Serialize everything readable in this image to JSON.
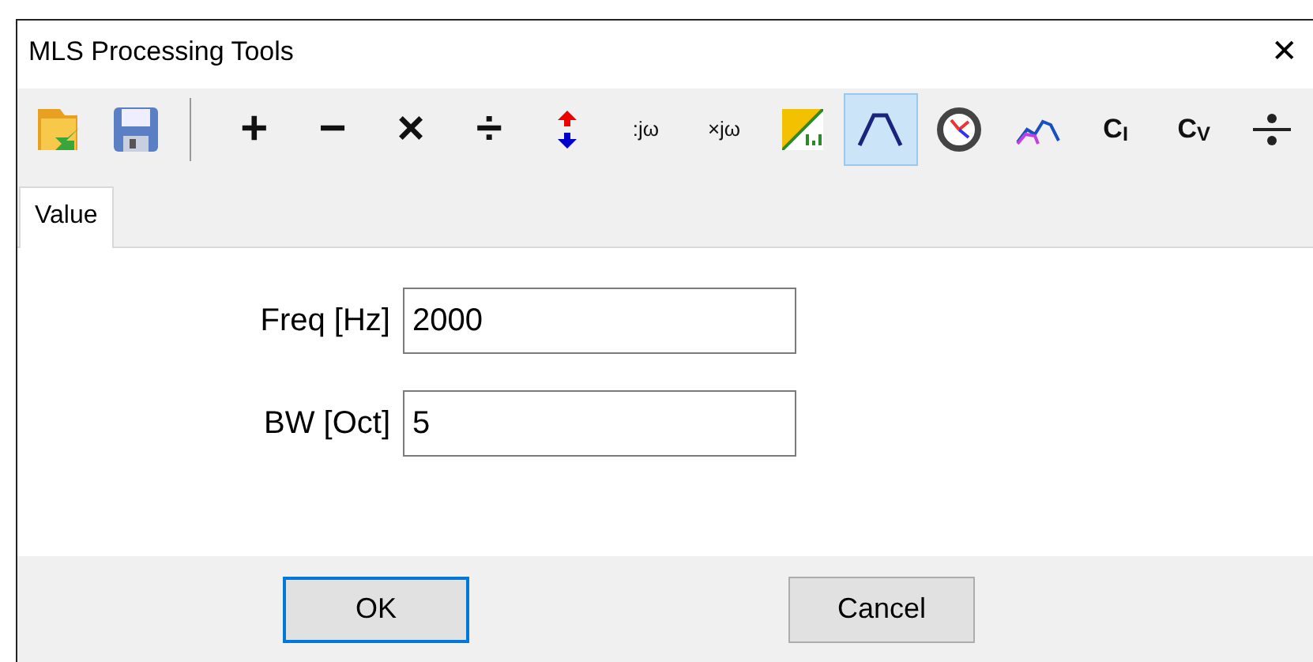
{
  "window": {
    "title": "MLS Processing Tools",
    "close": "✕"
  },
  "toolbar": [
    {
      "kind": "open",
      "selected": false
    },
    {
      "kind": "save",
      "selected": false
    },
    {
      "kind": "separator"
    },
    {
      "kind": "text",
      "label": "+",
      "selected": false
    },
    {
      "kind": "text",
      "label": "−",
      "selected": false
    },
    {
      "kind": "text",
      "label": "×",
      "selected": false
    },
    {
      "kind": "text",
      "label": "÷",
      "selected": false
    },
    {
      "kind": "updown",
      "selected": false
    },
    {
      "kind": "small",
      "label": ":jω",
      "selected": false
    },
    {
      "kind": "small",
      "label": "×jω",
      "selected": false
    },
    {
      "kind": "spl",
      "selected": false
    },
    {
      "kind": "bandpass",
      "selected": true
    },
    {
      "kind": "clock",
      "selected": false
    },
    {
      "kind": "curve",
      "selected": false
    },
    {
      "kind": "sub",
      "label": "C$_{I}$",
      "selected": false
    },
    {
      "kind": "sub",
      "label": "C$_{V}$",
      "selected": false
    },
    {
      "kind": "divline",
      "selected": false
    }
  ],
  "tabs": [
    {
      "label": "Value",
      "selected": true
    }
  ],
  "fields": [
    {
      "label": "Freq [Hz]",
      "value": "2000"
    },
    {
      "label": "BW [Oct]",
      "value": "5"
    }
  ],
  "buttons": [
    {
      "label": "OK",
      "focused": true
    },
    {
      "label": "Cancel",
      "focused": false
    }
  ]
}
